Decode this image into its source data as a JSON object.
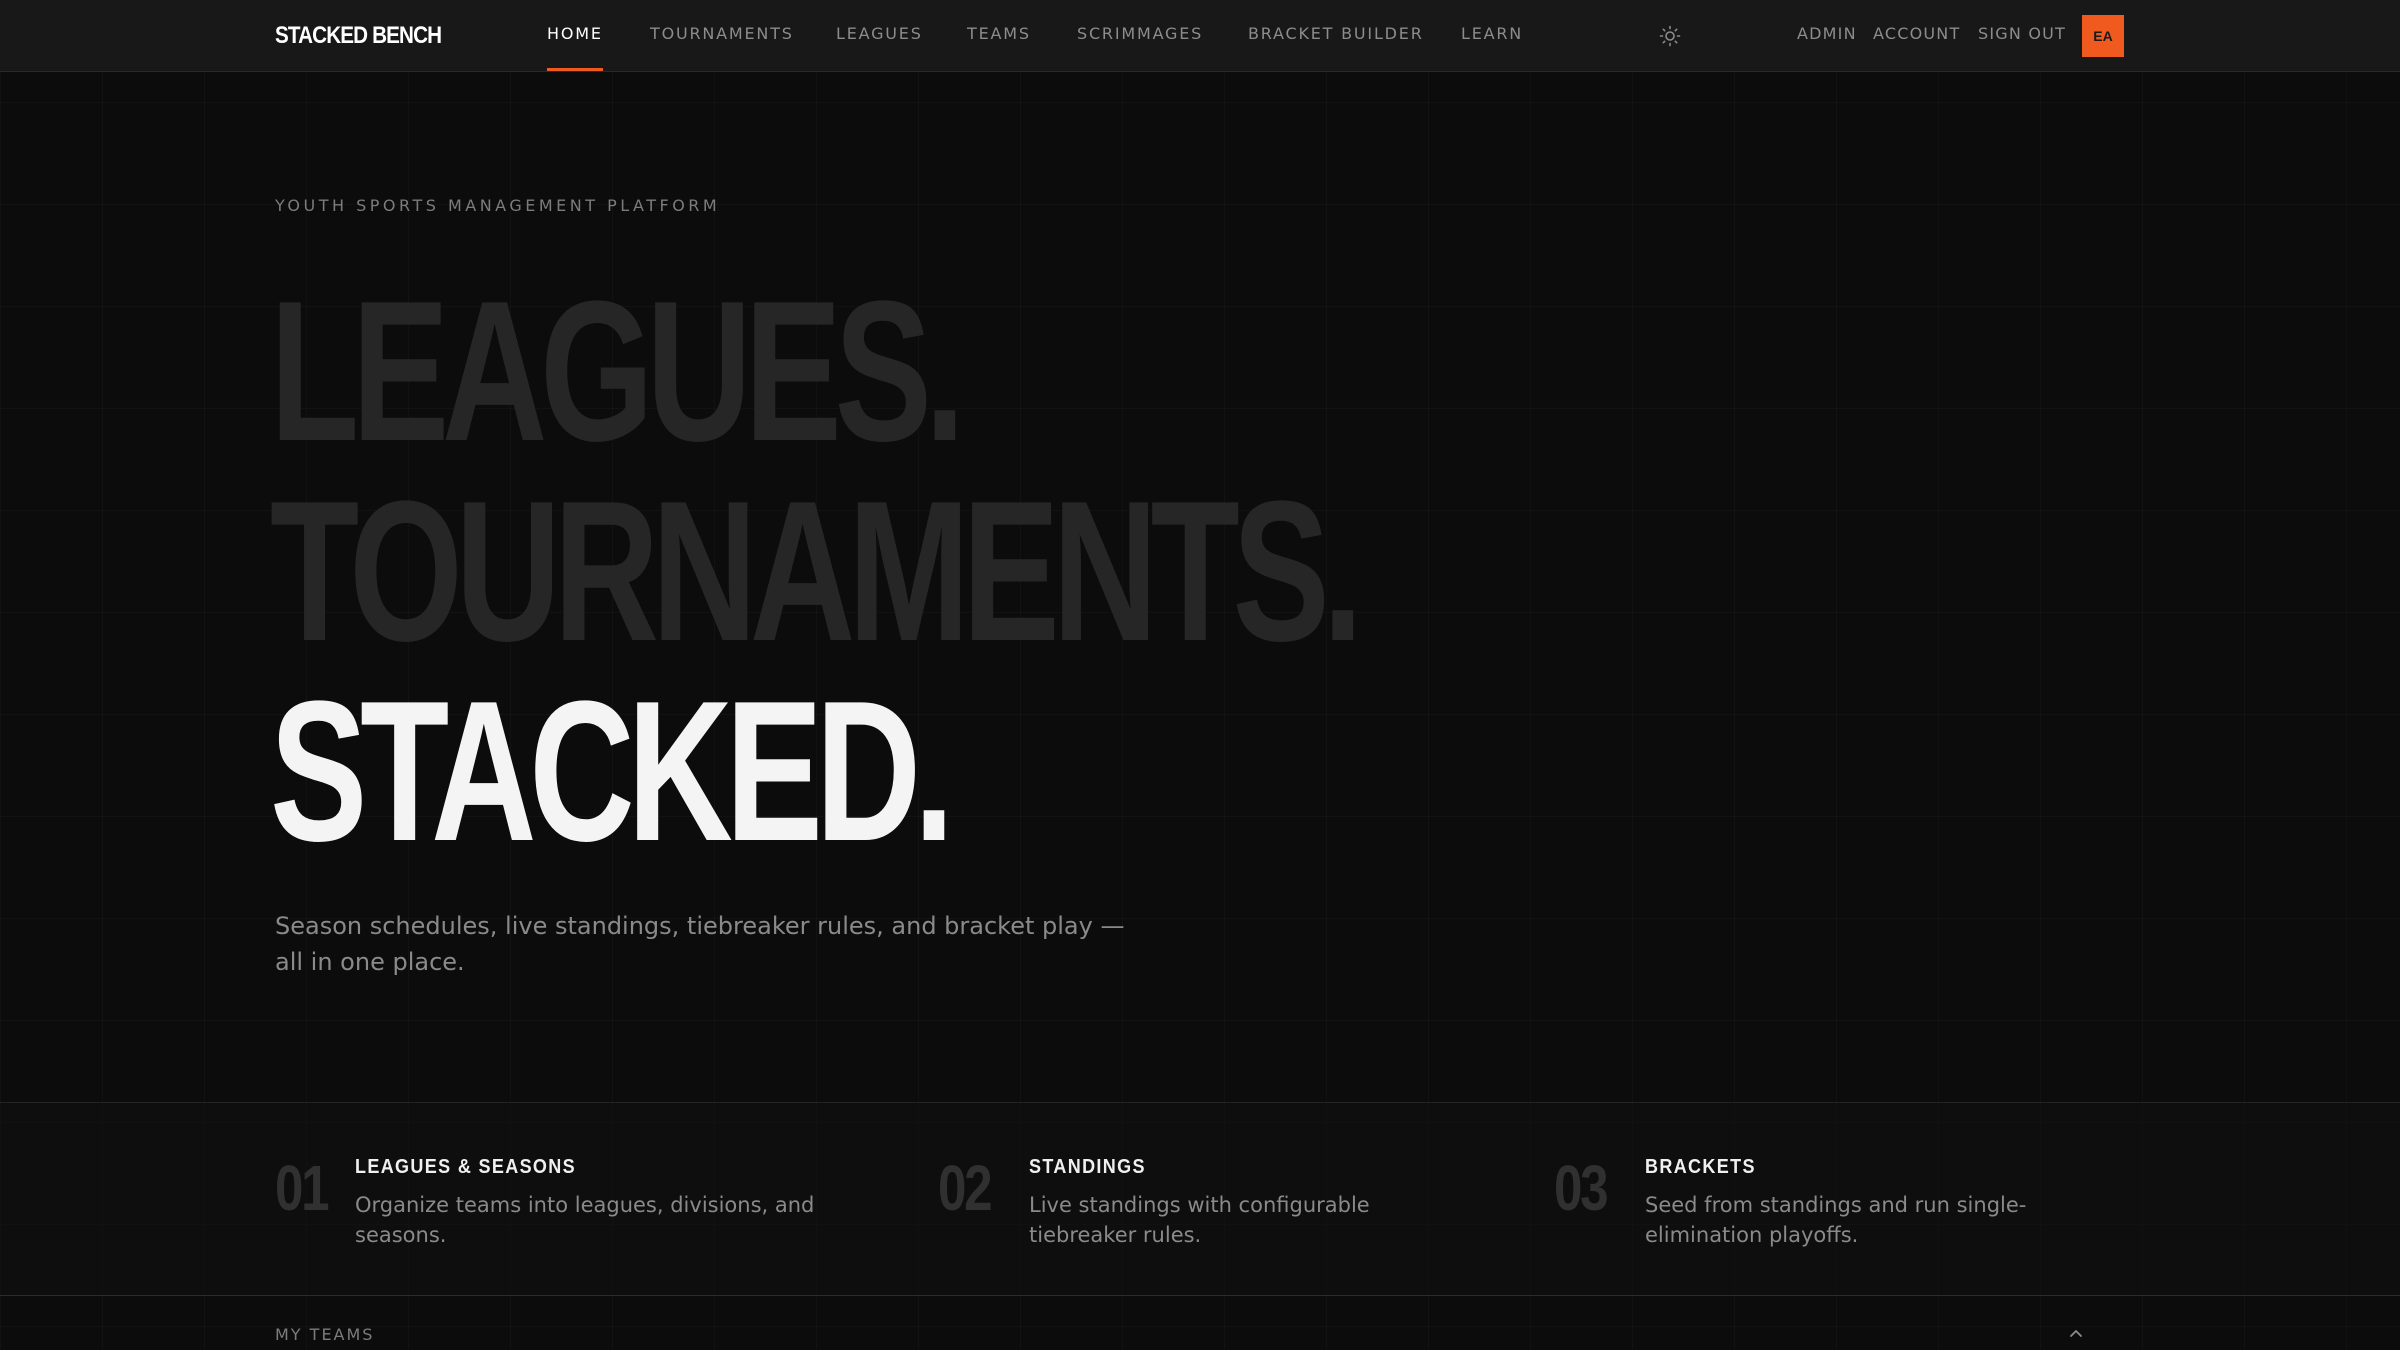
{
  "brand": {
    "name": "STACKED BENCH"
  },
  "nav": {
    "items": [
      {
        "label": "HOME",
        "active": true
      },
      {
        "label": "TOURNAMENTS",
        "active": false
      },
      {
        "label": "LEAGUES",
        "active": false
      },
      {
        "label": "TEAMS",
        "active": false
      },
      {
        "label": "SCRIMMAGES",
        "active": false
      },
      {
        "label": "BRACKET BUILDER",
        "active": false
      },
      {
        "label": "LEARN",
        "active": false
      }
    ],
    "theme_toggle_icon": "sun-icon",
    "utility": {
      "admin": "ADMIN",
      "account": "ACCOUNT",
      "sign_out": "SIGN OUT",
      "avatar_initials": "EA"
    }
  },
  "hero": {
    "eyebrow": "YOUTH SPORTS MANAGEMENT PLATFORM",
    "line1": "LEAGUES.",
    "line2": "TOURNAMENTS.",
    "line3": "STACKED.",
    "subtitle": "Season schedules, live standings, tiebreaker rules, and bracket play — all in one place."
  },
  "features": [
    {
      "number": "01",
      "title": "LEAGUES & SEASONS",
      "description": "Organize teams into leagues, divisions, and seasons."
    },
    {
      "number": "02",
      "title": "STANDINGS",
      "description": "Live standings with configurable tiebreaker rules."
    },
    {
      "number": "03",
      "title": "BRACKETS",
      "description": "Seed from standings and run single-elimination playoffs."
    }
  ],
  "my_teams": {
    "label": "MY TEAMS",
    "toggle_icon": "chevron-up-icon"
  },
  "colors": {
    "accent": "#f15a1f",
    "background": "#0c0c0c",
    "navbar": "#181818",
    "text_primary": "#f4f4f4",
    "text_muted": "#8a8a8a",
    "hero_dim": "#262626"
  }
}
